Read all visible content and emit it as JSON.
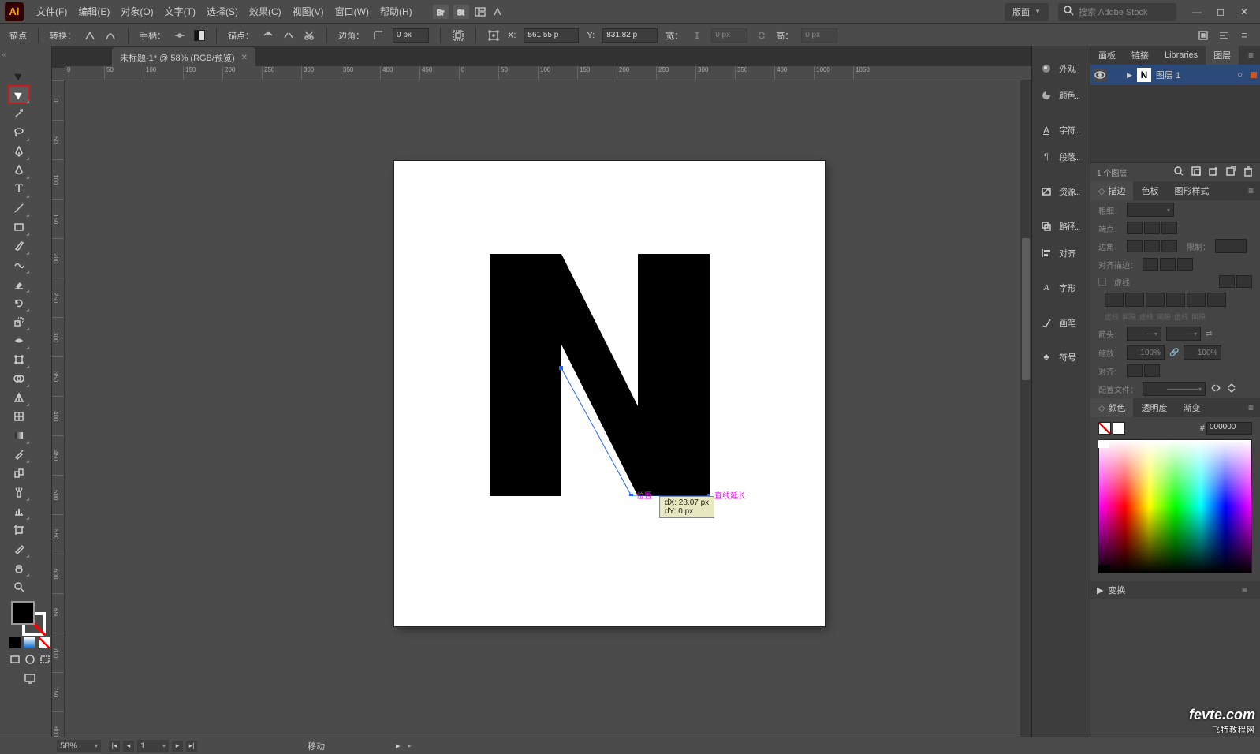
{
  "app": {
    "logo": "Ai"
  },
  "menu": {
    "file": "文件(F)",
    "edit": "编辑(E)",
    "object": "对象(O)",
    "type": "文字(T)",
    "select": "选择(S)",
    "effect": "效果(C)",
    "view": "视图(V)",
    "window": "窗口(W)",
    "help": "帮助(H)"
  },
  "workspace": {
    "label": "版面"
  },
  "search": {
    "placeholder": "搜索 Adobe Stock"
  },
  "ctrl": {
    "anchor": "锚点",
    "convert": "转换：",
    "handle": "手柄：",
    "anchors": "锚点：",
    "corner_label": "边角：",
    "corner_value": "0 px",
    "x_label": "X:",
    "x_value": "561.55 p",
    "y_label": "Y:",
    "y_value": "831.82 p",
    "w_label": "宽：",
    "w_value": "0 px",
    "h_label": "高：",
    "h_value": "0 px"
  },
  "tab": {
    "title": "未标题-1* @ 58% (RGB/预览)"
  },
  "hruler": [
    "0",
    "50",
    "100",
    "150",
    "200",
    "250",
    "300",
    "350",
    "400",
    "450",
    "0",
    "50",
    "100",
    "150",
    "200",
    "250",
    "300",
    "350",
    "400",
    "1000",
    "1050"
  ],
  "vruler": [
    "0",
    "50",
    "100",
    "150",
    "200",
    "250",
    "300",
    "350",
    "400",
    "450",
    "500",
    "550",
    "600",
    "650",
    "700",
    "750",
    "800"
  ],
  "canvas": {
    "hint_pos": "位置",
    "hint_ext": "直线延长",
    "tooltip_dx": "dX: 28.07 px",
    "tooltip_dy": "dY: 0 px"
  },
  "dock": {
    "appearance": "外观",
    "color": "颜色...",
    "character": "字符...",
    "paragraph": "段落...",
    "assets": "资源...",
    "pathfinder": "路径...",
    "align": "对齐",
    "glyph": "字形",
    "brush": "画笔",
    "symbol": "符号"
  },
  "layers": {
    "tabs": {
      "artboard": "画板",
      "links": "链接",
      "libraries": "Libraries",
      "layers": "图层"
    },
    "row": {
      "name": "图层 1"
    },
    "footer": "1 个图层"
  },
  "stroke": {
    "tabs": {
      "stroke": "描边",
      "swatches": "色板",
      "gstyle": "图形样式"
    },
    "weight": "粗细：",
    "cap": "端点：",
    "corner2": "边角：",
    "limit": "限制：",
    "alignstroke": "对齐描边：",
    "dashed": "虚线",
    "dashlabels": [
      "虚线",
      "间隙",
      "虚线",
      "间隙",
      "虚线",
      "间隙"
    ],
    "arrow": "箭头：",
    "scale": "缩放：",
    "scale_v": "100%",
    "align2": "对齐：",
    "profile": "配置文件："
  },
  "colorp": {
    "tabs": {
      "color": "颜色",
      "opacity": "透明度",
      "gradient": "渐变"
    },
    "hex_prefix": "#",
    "hex": "000000"
  },
  "transform": {
    "label": "变换"
  },
  "status": {
    "zoom": "58%",
    "page": "1",
    "tool": "移动"
  },
  "watermark": {
    "main": "fevte.com",
    "sub": "飞特教程网"
  }
}
